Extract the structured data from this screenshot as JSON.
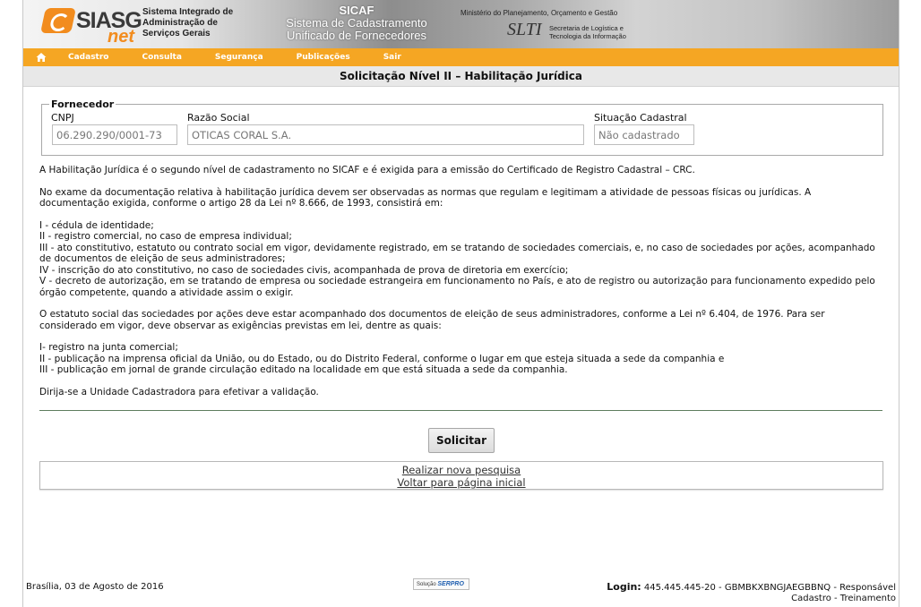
{
  "header": {
    "logo_text": "SIASG",
    "logo_net": "net",
    "system_name": [
      "Sistema Integrado de",
      "Administração de",
      "Serviços Gerais"
    ],
    "sicaf_title": "SICAF",
    "sicaf_subtitle": [
      "Sistema de Cadastramento",
      "Unificado de Fornecedores"
    ],
    "ministry": "Ministério do Planejamento, Orçamento e Gestão",
    "slti": "SLTI",
    "slti_desc": [
      "Secretaria de Logística e",
      "Tecnologia da Informação"
    ]
  },
  "menu": {
    "items": [
      "Cadastro",
      "Consulta",
      "Segurança",
      "Publicações",
      "Sair"
    ]
  },
  "page_title": "Solicitação Nível II – Habilitação Jurídica",
  "fornecedor": {
    "legend": "Fornecedor",
    "cnpj_label": "CNPJ",
    "cnpj_value": "06.290.290/0001-73",
    "razao_label": "Razão Social",
    "razao_value": "OTICAS CORAL S.A.",
    "situacao_label": "Situação Cadastral",
    "situacao_value": "Não cadastrado"
  },
  "content": {
    "p1": "A Habilitação Jurídica é o segundo nível de cadastramento no SICAF e é exigida para a emissão do Certificado de Registro Cadastral – CRC.",
    "p2": "No exame da documentação relativa à habilitação jurídica devem ser observadas as normas que regulam e legitimam a atividade de pessoas físicas ou jurídicas. A documentação exigida, conforme o artigo 28 da Lei nº 8.666, de 1993, consistirá em:",
    "list1": [
      "I - cédula de identidade;",
      "II - registro comercial, no caso de empresa individual;",
      "III - ato constitutivo, estatuto ou contrato social em vigor, devidamente registrado, em se tratando de sociedades comerciais, e, no caso de sociedades por ações, acompanhado de documentos de eleição de seus administradores;",
      "IV - inscrição do ato constitutivo, no caso de sociedades civis, acompanhada de prova de diretoria em exercício;",
      "V - decreto de autorização, em se tratando de empresa ou sociedade estrangeira em funcionamento no País, e ato de registro ou autorização para funcionamento expedido pelo órgão competente, quando a atividade assim o exigir."
    ],
    "p3": "O estatuto social das sociedades por ações deve estar acompanhado dos documentos de eleição de seus administradores, conforme a Lei nº 6.404, de 1976. Para ser considerado em vigor, deve observar as exigências previstas em lei, dentre as quais:",
    "list2": [
      "I- registro na junta comercial;",
      "II - publicação na imprensa oficial da União, ou do Estado, ou do Distrito Federal, conforme o lugar em que esteja situada a sede da companhia e",
      "III - publicação em jornal de grande circulação editado na localidade em que está situada a sede da companhia."
    ],
    "p4": "Dirija-se a Unidade Cadastradora para efetivar a validação."
  },
  "actions": {
    "submit_label": "Solicitar",
    "link_new_search": "Realizar nova pesquisa",
    "link_home": "Voltar para página inicial"
  },
  "footer": {
    "date": "Brasília, 03 de Agosto de 2016",
    "logo_prefix": "Solução",
    "logo_name": "SERPRO",
    "login_label": "Login:",
    "login_value": "445.445.445-20 - GBMBKXBNGJAEGBBNQ - Responsável Cadastro - Treinamento"
  },
  "colors": {
    "menu_bg": "#f5a623",
    "title_bar_bg": "#e8e8e8",
    "divider": "#5e7d5e"
  }
}
